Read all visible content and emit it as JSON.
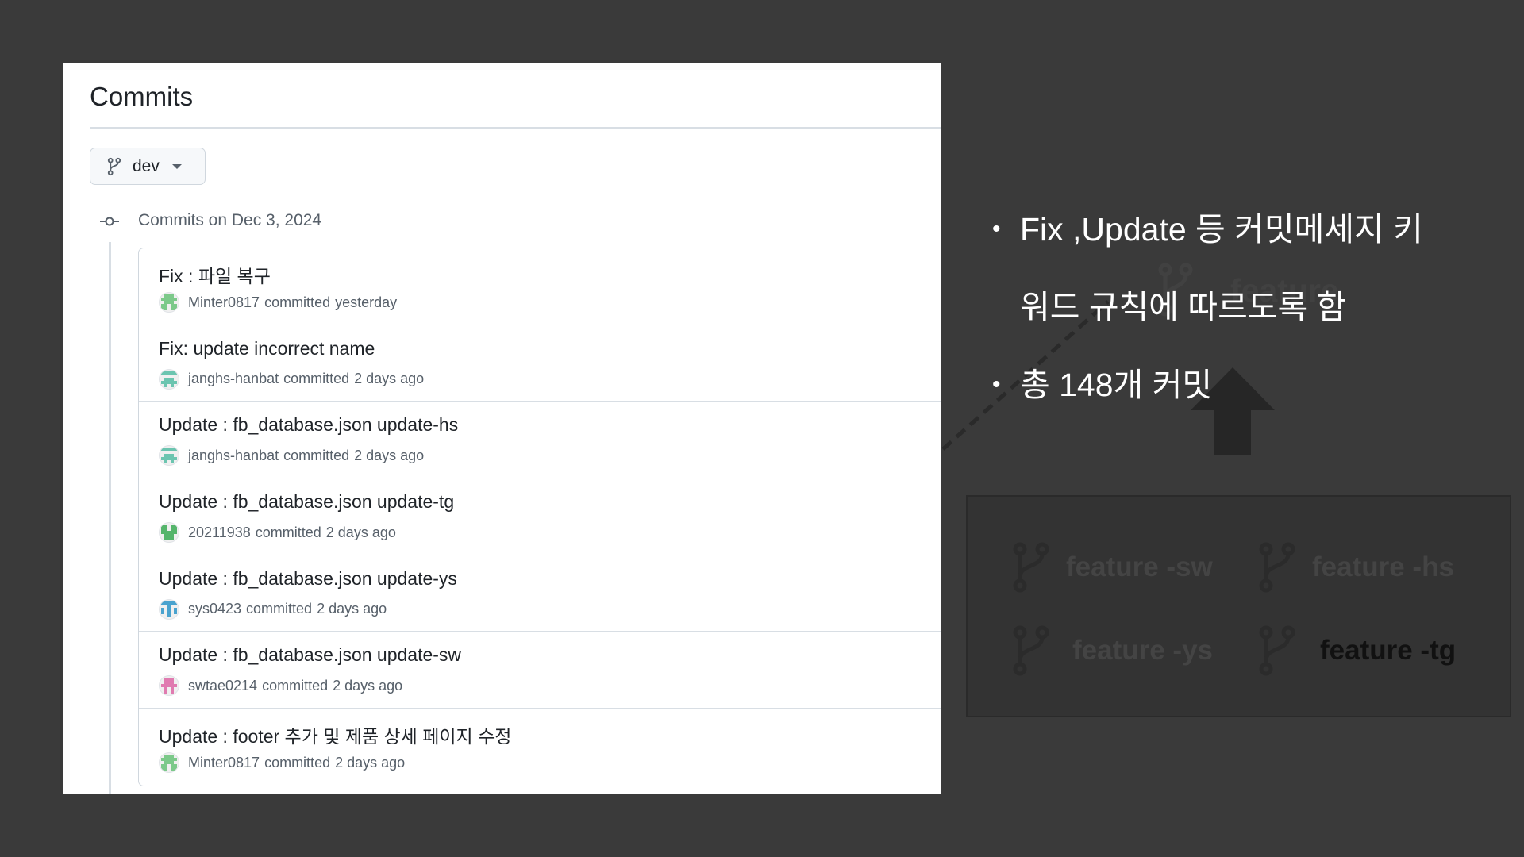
{
  "github": {
    "page_title": "Commits",
    "branch_selector": {
      "label": "dev",
      "icon": "git-branch-icon"
    },
    "group_heading": "Commits on Dec 3, 2024",
    "commits": [
      {
        "message": "Fix : 파일 복구",
        "author": "Minter0817",
        "action": "committed",
        "time": "yesterday",
        "avatar_color": "#7cc98a"
      },
      {
        "message": "Fix: update incorrect name",
        "author": "janghs-hanbat",
        "action": "committed",
        "time": "2 days ago",
        "avatar_color": "#6cc5b0"
      },
      {
        "message": "Update : fb_database.json update-hs",
        "author": "janghs-hanbat",
        "action": "committed",
        "time": "2 days ago",
        "avatar_color": "#6cc5b0"
      },
      {
        "message": "Update : fb_database.json update-tg",
        "author": "20211938",
        "action": "committed",
        "time": "2 days ago",
        "avatar_color": "#55b56b"
      },
      {
        "message": "Update : fb_database.json update-ys",
        "author": "sys0423",
        "action": "committed",
        "time": "2 days ago",
        "avatar_color": "#4aa3cf"
      },
      {
        "message": "Update : fb_database.json update-sw",
        "author": "swtae0214",
        "action": "committed",
        "time": "2 days ago",
        "avatar_color": "#e07bb0"
      },
      {
        "message": "Update : footer 추가 및 제품 상세 페이지 수정",
        "author": "Minter0817",
        "action": "committed",
        "time": "2 days ago",
        "avatar_color": "#7cc98a"
      }
    ]
  },
  "slide": {
    "bullets": [
      "Fix ,Update 등 커밋메세지 키워드 규칙에 따르도록 함",
      "총 148개 커밋"
    ],
    "bullet_lines": [
      "Fix ,Update 등 커밋메세지 키",
      "워드 규칙에 따르도록 함",
      "총 148개 커밋"
    ],
    "ghost_branch_label": "feature",
    "branches": [
      {
        "label": "feature -sw",
        "active": false
      },
      {
        "label": "feature -hs",
        "active": false
      },
      {
        "label": "feature -ys",
        "active": false
      },
      {
        "label": "feature -tg",
        "active": true
      }
    ],
    "colors": {
      "background": "#3a3a3a",
      "panel": "#ffffff",
      "branch_box": "#333333",
      "active_branch_text": "#111111",
      "inactive_branch_text": "#444444"
    }
  }
}
